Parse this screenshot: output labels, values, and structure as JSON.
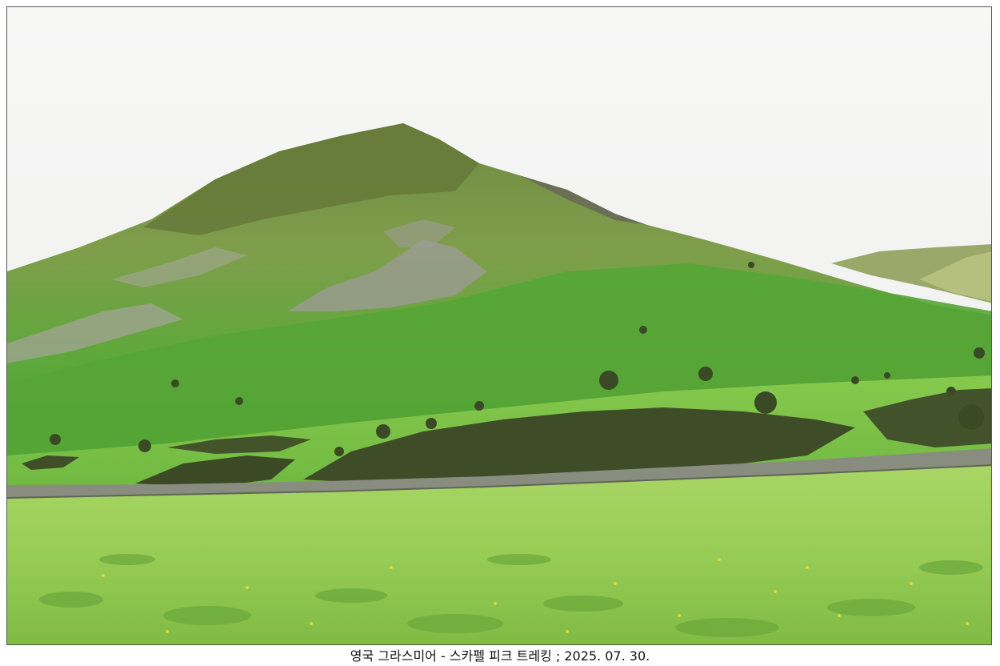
{
  "caption": {
    "text": "영국 그라스미어 - 스카펠 피크 트레킹 ; 2025. 07. 30."
  },
  "colors": {
    "sky": "#f3f4f3",
    "mountain_upper": "#7d9a4a",
    "mountain_lower": "#5fa33a",
    "scree": "#9b9a94",
    "valley_pasture": "#8fcb4f",
    "meadow": "#9fd35a",
    "gorse": "#3f4d28",
    "stone_wall": "#8a8f82"
  }
}
